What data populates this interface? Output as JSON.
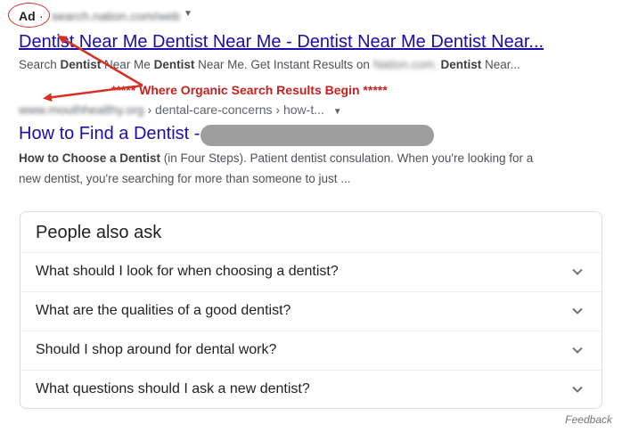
{
  "ad": {
    "label": "Ad",
    "separator": "·",
    "url": "search.nation.com/web",
    "title": "Dentist Near Me Dentist Near Me - Dentist Near Me Dentist Near...",
    "snippet": {
      "p1": "Search ",
      "b1": "Dentist",
      "p2": " Near Me ",
      "b2": "Dentist",
      "p3": " Near Me. Get Instant Results on ",
      "blurred": "Nation.com.",
      "p4": " ",
      "b3": "Dentist",
      "p5": " Near..."
    }
  },
  "annotation": "*****  Where Organic Search Results Begin *****",
  "organic": {
    "url_blurred": "www.mouthhealthy.org",
    "breadcrumb": " › dental-care-concerns › how-t...",
    "title": "How to Find a Dentist -",
    "snippet": {
      "b1": "How to Choose a Dentist",
      "rest": " (in Four Steps). Patient dentist consulation. When you're looking for a new dentist, you're searching for more than someone to just ..."
    }
  },
  "people_also_ask": {
    "title": "People also ask",
    "questions": [
      "What should I look for when choosing a dentist?",
      "What are the qualities of a good dentist?",
      "Should I shop around for dental work?",
      "What questions should I ask a new dentist?"
    ]
  },
  "feedback": "Feedback",
  "colors": {
    "link": "#1a0dab",
    "annotation_red": "#c5221f",
    "text": "#202124",
    "muted": "#5f6368"
  },
  "icons": [
    "caret-down-icon",
    "chevron-down-icon",
    "red-arrow-annotation"
  ]
}
